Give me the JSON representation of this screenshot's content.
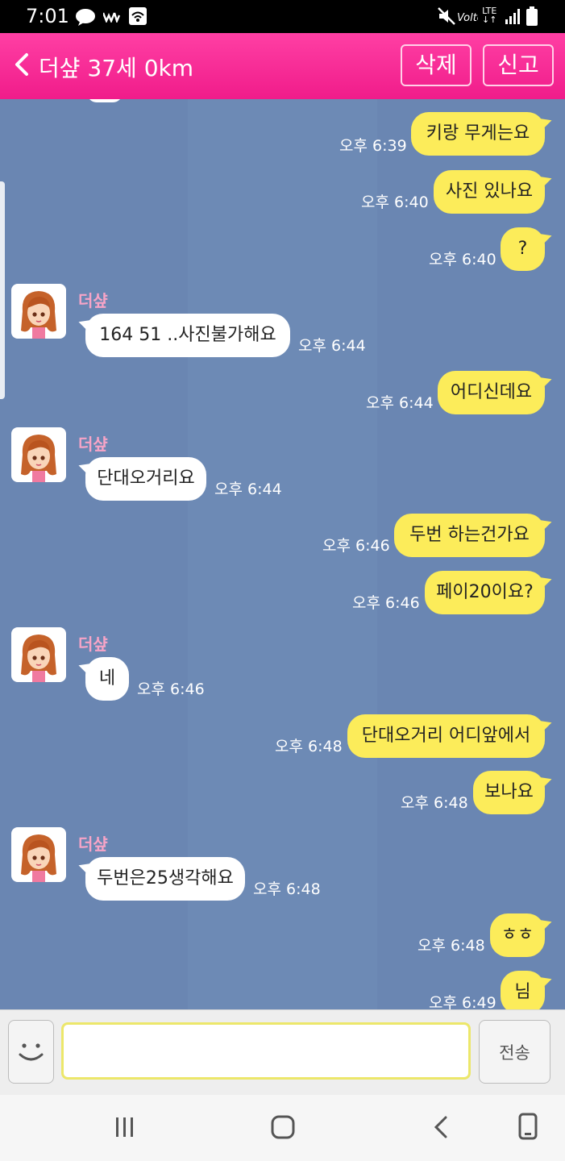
{
  "status_bar": {
    "time": "7:01",
    "network": "LTE"
  },
  "header": {
    "title": "더샾 37세 0km",
    "delete_label": "삭제",
    "report_label": "신고"
  },
  "colors": {
    "header": "#f52a94",
    "chat_bg": "#6a86b2",
    "my_bubble": "#fcec5a",
    "their_bubble": "#ffffff",
    "sender_name": "#f7a4c7"
  },
  "messages": [
    {
      "from": "me",
      "text": "키랑  무게는요",
      "time": "오후 6:39"
    },
    {
      "from": "me",
      "text": "사진 있나요",
      "time": "오후 6:40"
    },
    {
      "from": "me",
      "text": "?",
      "time": "오후 6:40"
    },
    {
      "from": "them",
      "sender": "더샾",
      "text": "164  51  ..사진불가해요",
      "time": "오후 6:44"
    },
    {
      "from": "me",
      "text": "어디신데요",
      "time": "오후 6:44"
    },
    {
      "from": "them",
      "sender": "더샾",
      "text": "단대오거리요",
      "time": "오후 6:44"
    },
    {
      "from": "me",
      "text": "두번  하는건가요",
      "time": "오후 6:46"
    },
    {
      "from": "me",
      "text": "페이20이요?",
      "time": "오후 6:46"
    },
    {
      "from": "them",
      "sender": "더샾",
      "text": "네",
      "time": "오후 6:46"
    },
    {
      "from": "me",
      "text": "단대오거리 어디앞에서",
      "time": "오후 6:48"
    },
    {
      "from": "me",
      "text": "보나요",
      "time": "오후 6:48"
    },
    {
      "from": "them",
      "sender": "더샾",
      "text": "두번은25생각해요",
      "time": "오후 6:48"
    },
    {
      "from": "me",
      "text": "ㅎㅎ",
      "time": "오후 6:48"
    },
    {
      "from": "me",
      "text": "님",
      "time": "오후 6:49"
    }
  ],
  "composer": {
    "value": "",
    "send_label": "전송"
  }
}
